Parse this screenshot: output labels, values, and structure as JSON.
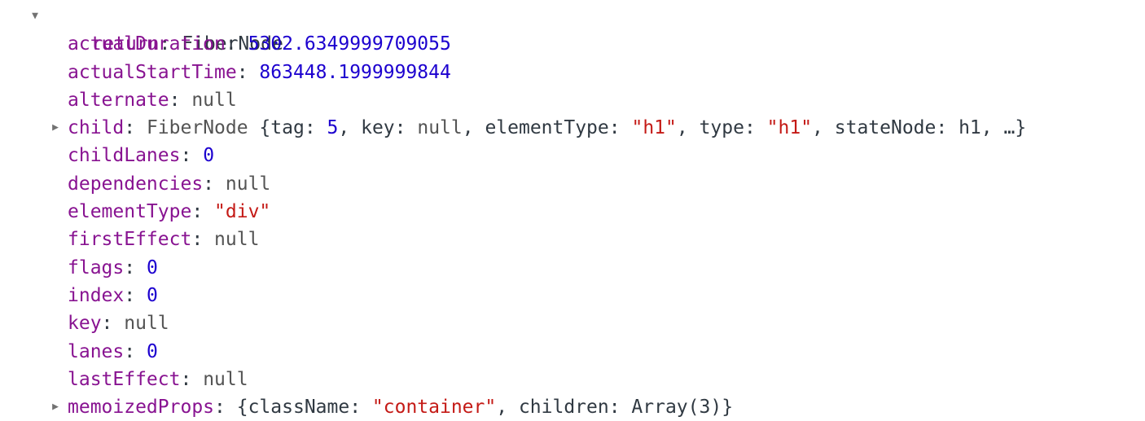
{
  "colors": {
    "key": "#881391",
    "number": "#1c00cf",
    "string": "#c41a16",
    "null": "#545454",
    "text": "#303942",
    "arrow": "#727272"
  },
  "tree": {
    "root": {
      "arrow": "▼",
      "key": "return",
      "sep": ": ",
      "value": "FiberNode"
    },
    "props": [
      {
        "key": "actualDuration",
        "value": "5302.6349999709055",
        "type": "number"
      },
      {
        "key": "actualStartTime",
        "value": "863448.1999999844",
        "type": "number"
      },
      {
        "key": "alternate",
        "value": "null",
        "type": "null"
      },
      {
        "key": "child",
        "expandable": true,
        "arrow": "▶",
        "preview": {
          "class_name": "FiberNode",
          "open": " {",
          "entries": [
            {
              "key": "tag",
              "value": "5",
              "type": "number"
            },
            {
              "key": "key",
              "value": "null",
              "type": "null"
            },
            {
              "key": "elementType",
              "value": "\"h1\"",
              "type": "string"
            },
            {
              "key": "type",
              "value": "\"h1\"",
              "type": "string"
            },
            {
              "key": "stateNode",
              "value": "h1",
              "type": "plain"
            }
          ],
          "ellipsis": "…",
          "close": "}"
        }
      },
      {
        "key": "childLanes",
        "value": "0",
        "type": "number"
      },
      {
        "key": "dependencies",
        "value": "null",
        "type": "null"
      },
      {
        "key": "elementType",
        "value": "\"div\"",
        "type": "string"
      },
      {
        "key": "firstEffect",
        "value": "null",
        "type": "null"
      },
      {
        "key": "flags",
        "value": "0",
        "type": "number"
      },
      {
        "key": "index",
        "value": "0",
        "type": "number"
      },
      {
        "key": "key",
        "value": "null",
        "type": "null"
      },
      {
        "key": "lanes",
        "value": "0",
        "type": "number"
      },
      {
        "key": "lastEffect",
        "value": "null",
        "type": "null"
      },
      {
        "key": "memoizedProps",
        "expandable": true,
        "arrow": "▶",
        "preview": {
          "class_name": "",
          "open": "{",
          "entries": [
            {
              "key": "className",
              "value": "\"container\"",
              "type": "string"
            },
            {
              "key": "children",
              "value": "Array(3)",
              "type": "plain"
            }
          ],
          "ellipsis": "",
          "close": "}"
        }
      }
    ]
  }
}
